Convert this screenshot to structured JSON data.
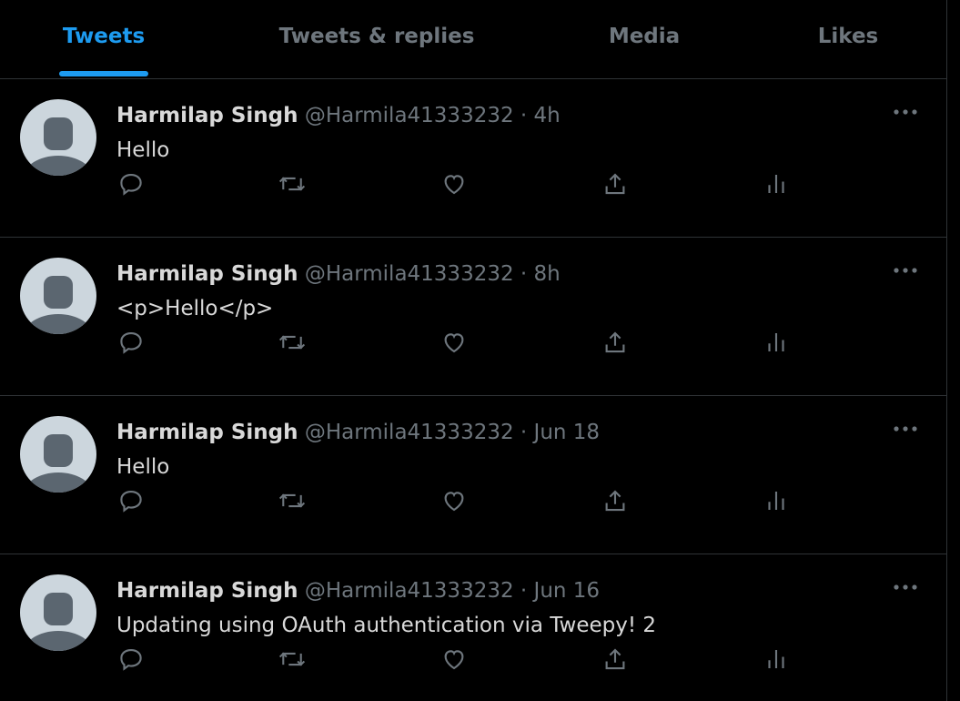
{
  "tabs": [
    {
      "label": "Tweets",
      "active": true
    },
    {
      "label": "Tweets & replies",
      "active": false
    },
    {
      "label": "Media",
      "active": false
    },
    {
      "label": "Likes",
      "active": false
    }
  ],
  "tweets": [
    {
      "name": "Harmilap Singh",
      "handle": "@Harmila41333232",
      "separator": "·",
      "time": "4h",
      "text": "Hello"
    },
    {
      "name": "Harmilap Singh",
      "handle": "@Harmila41333232",
      "separator": "·",
      "time": "8h",
      "text": "<p>Hello</p>"
    },
    {
      "name": "Harmilap Singh",
      "handle": "@Harmila41333232",
      "separator": "·",
      "time": "Jun 18",
      "text": "Hello"
    },
    {
      "name": "Harmilap Singh",
      "handle": "@Harmila41333232",
      "separator": "·",
      "time": "Jun 16",
      "text": "Updating using OAuth authentication via Tweepy! 2"
    }
  ],
  "icons": {
    "reply": "reply-icon",
    "retweet": "retweet-icon",
    "like": "like-icon",
    "share": "share-icon",
    "analytics": "analytics-icon",
    "more": "more-icon",
    "avatar": "default-avatar-icon"
  },
  "colors": {
    "background": "#000000",
    "accent": "#1d9bf0",
    "text": "#d9d9d9",
    "secondary": "#6e767d",
    "divider": "#2f3336",
    "avatar_bg": "#ccd6dd",
    "avatar_fg": "#5b6670"
  }
}
